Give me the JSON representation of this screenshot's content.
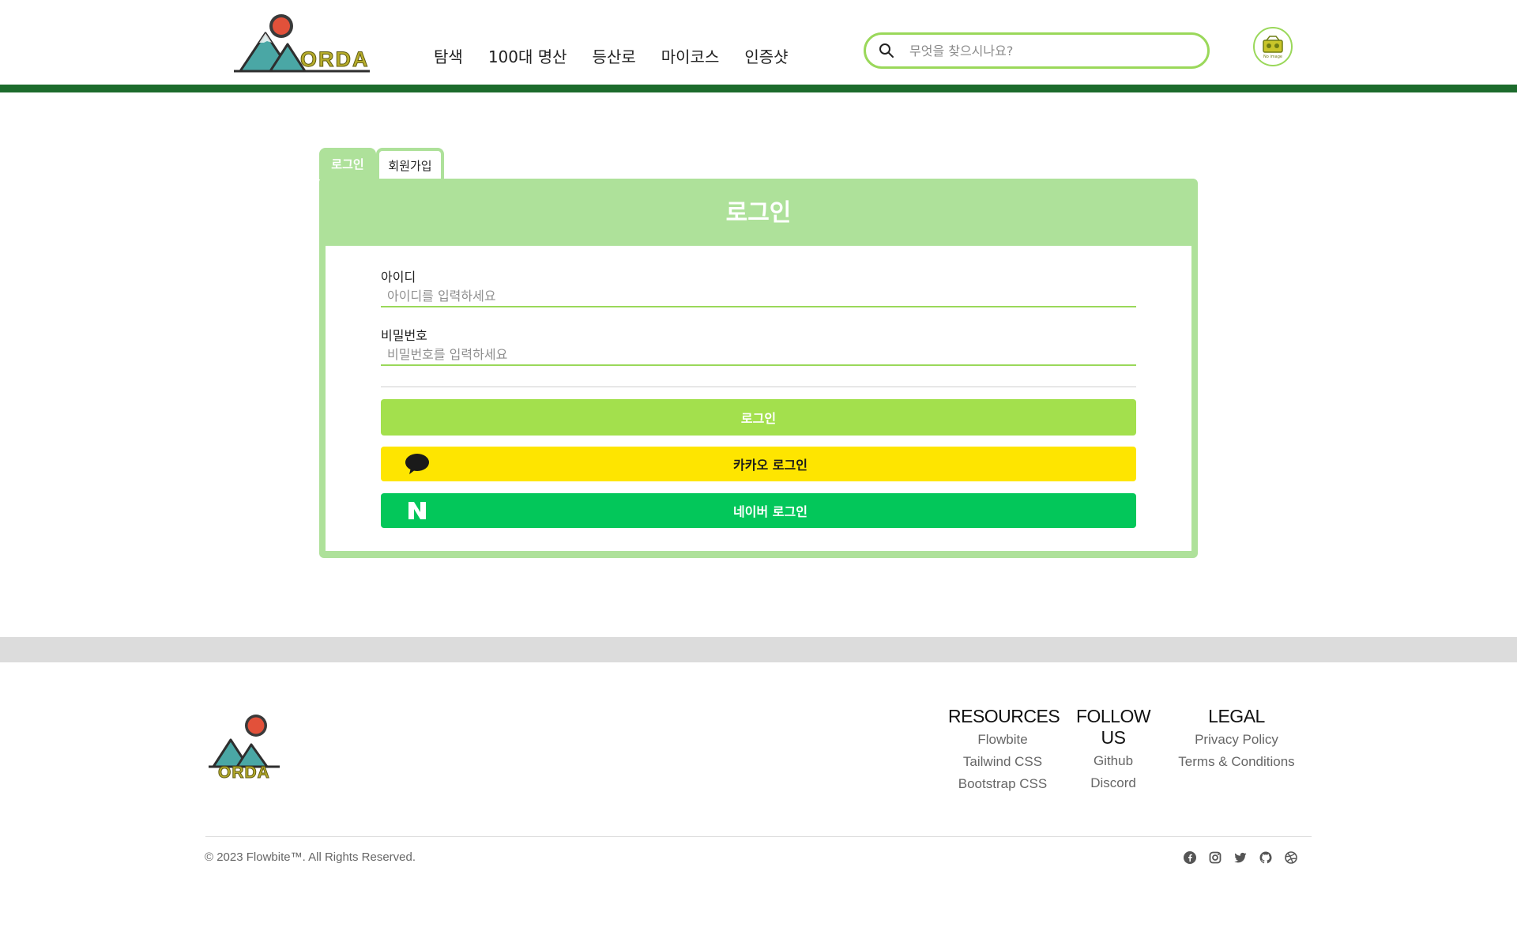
{
  "header": {
    "logo_text": "ORDA",
    "nav": [
      "탐색",
      "100대 명산",
      "등산로",
      "마이코스",
      "인증샷"
    ],
    "search_placeholder": "무엇을 찾으시나요?",
    "avatar_label": "No image"
  },
  "login": {
    "tabs": {
      "login": "로그인",
      "signup": "회원가입"
    },
    "title": "로그인",
    "id_label": "아이디",
    "id_placeholder": "아이디를 입력하세요",
    "pw_label": "비밀번호",
    "pw_placeholder": "비밀번호를 입력하세요",
    "login_button": "로그인",
    "kakao_button": "카카오 로그인",
    "naver_button": "네이버 로그인"
  },
  "footer": {
    "logo_text": "ORDA",
    "columns": [
      {
        "title": "RESOURCES",
        "links": [
          "Flowbite",
          "Tailwind CSS",
          "Bootstrap CSS"
        ]
      },
      {
        "title": "FOLLOW US",
        "links": [
          "Github",
          "Discord"
        ]
      },
      {
        "title": "LEGAL",
        "links": [
          "Privacy Policy",
          "Terms & Conditions"
        ]
      }
    ],
    "copyright": "© 2023 Flowbite™. All Rights Reserved.",
    "social_icons": [
      "facebook-icon",
      "instagram-icon",
      "twitter-icon",
      "github-icon",
      "dribbble-icon"
    ]
  },
  "colors": {
    "header_bar": "#1c6b2c",
    "accent_green": "#aee19a",
    "login_button": "#a3e04d",
    "kakao": "#fee500",
    "naver": "#03c75a"
  }
}
